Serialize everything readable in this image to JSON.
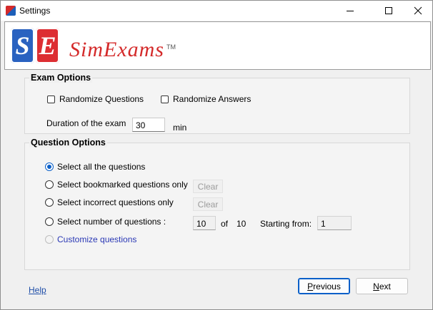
{
  "window": {
    "title": "Settings"
  },
  "banner": {
    "logo_letters": [
      "S",
      "E"
    ],
    "brand_name": "SimExams",
    "trademark": "TM"
  },
  "exam_options": {
    "legend": "Exam Options",
    "randomize_questions": {
      "label": "Randomize Questions",
      "checked": false
    },
    "randomize_answers": {
      "label": "Randomize Answers",
      "checked": false
    },
    "duration_label": "Duration of the exam",
    "duration_value": "30",
    "duration_unit": "min"
  },
  "question_options": {
    "legend": "Question Options",
    "selected": "all",
    "options": {
      "all": "Select all the questions",
      "bookmarked": "Select bookmarked questions only",
      "incorrect": "Select incorrect questions only",
      "number": "Select number of questions :",
      "customize": "Customize questions"
    },
    "clear_label": "Clear",
    "number_value": "10",
    "of_label": "of",
    "total": "10",
    "starting_from_label": "Starting from:",
    "starting_from_value": "1"
  },
  "footer": {
    "help_label": "Help",
    "previous_label": "Previous",
    "next_label": "Next"
  },
  "colors": {
    "accent": "#0a5fc8",
    "brand_red": "#d42a2a",
    "brand_blue": "#2a62c0",
    "link": "#1f4ea8"
  }
}
